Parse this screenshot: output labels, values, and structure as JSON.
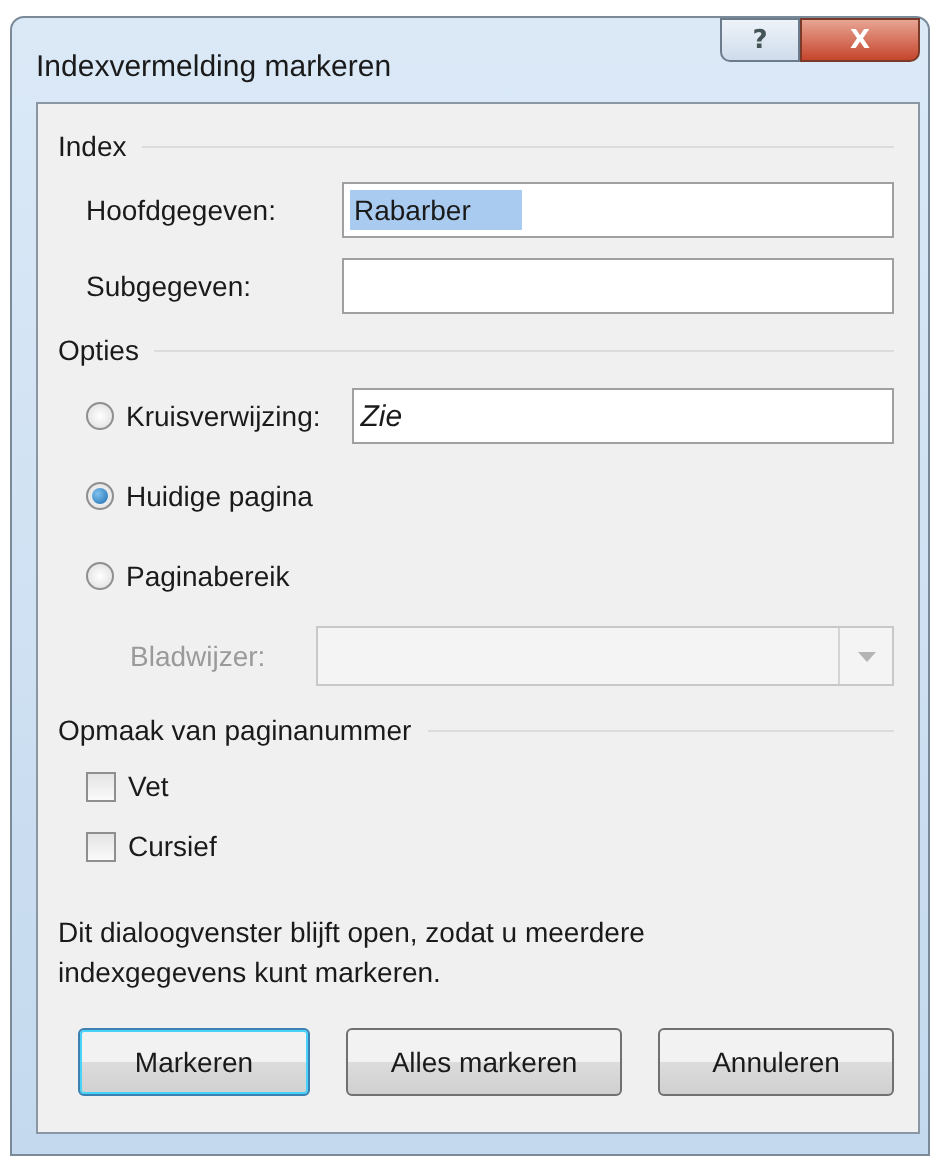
{
  "window": {
    "title": "Indexvermelding markeren",
    "help": "?",
    "close": "X"
  },
  "index": {
    "heading": "Index",
    "fields": [
      {
        "label": "Hoofdgegeven:",
        "value": "Rabarber",
        "highlighted": true
      },
      {
        "label": "Subgegeven:"
      }
    ]
  },
  "options": {
    "heading": "Opties",
    "items": [
      {
        "kind": "radio-field",
        "label": "Kruisverwijzing:",
        "selected": false,
        "value": "Zie"
      },
      {
        "kind": "radio",
        "label": "Huidige pagina",
        "selected": true
      },
      {
        "kind": "radio",
        "label": "Paginabereik",
        "selected": false
      },
      {
        "kind": "dropdown",
        "label": "Bladwijzer:",
        "disabled": true
      }
    ]
  },
  "format": {
    "heading": "Opmaak van paginanummer",
    "checkboxes": [
      {
        "label": "Vet",
        "checked": false
      },
      {
        "label": "Cursief",
        "checked": false
      }
    ]
  },
  "note": "Dit dialoogvenster blijft open, zodat u meerdere indexgegevens kunt markeren.",
  "buttons": [
    {
      "label": "Markeren",
      "default": true
    },
    {
      "label": "Alles markeren",
      "default": false
    },
    {
      "label": "Annuleren",
      "default": false
    }
  ]
}
